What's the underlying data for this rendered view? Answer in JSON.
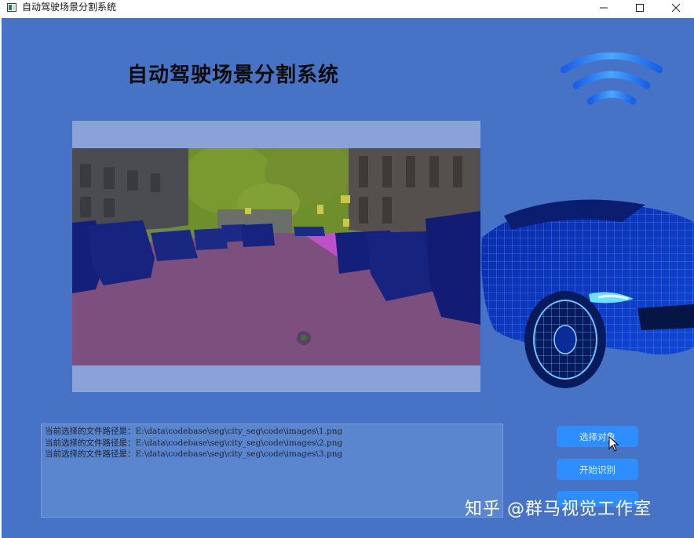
{
  "window": {
    "title": "自动驾驶场景分割系统",
    "icons": {
      "app": "app-icon",
      "minimize": "minimize-icon",
      "maximize": "maximize-icon",
      "close": "close-icon"
    }
  },
  "app": {
    "title": "自动驾驶场景分割系统"
  },
  "image_panel": {
    "content": "segmented-street-scene"
  },
  "log": {
    "lines": [
      "当前选择的文件路径是：E:\\data\\codebase\\seg\\city_seg\\code\\images\\1.png",
      "当前选择的文件路径是：E:\\data\\codebase\\seg\\city_seg\\code\\images\\2.png",
      "当前选择的文件路径是：E:\\data\\codebase\\seg\\city_seg\\code\\images\\3.png"
    ]
  },
  "buttons": {
    "select_label": "选择对象",
    "start_label": "开始识别",
    "third_label": ""
  },
  "watermark": "知乎 @群马视觉工作室",
  "colors": {
    "background": "#4673c6",
    "button": "#2f8eff",
    "segment_road": "#7d4f7e",
    "segment_vehicle": "#141f7c",
    "segment_vegetation": "#6f8e2c",
    "segment_building": "#4d4d55",
    "segment_sidewalk": "#c050c8"
  }
}
